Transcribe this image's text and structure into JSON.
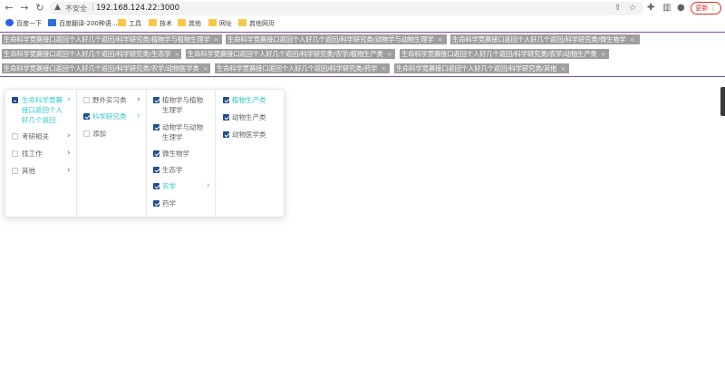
{
  "browser": {
    "insecure_label": "不安全",
    "url": "192.168.124.22:3000",
    "update_label": "更新"
  },
  "bookmarks": [
    {
      "label": "百度一下",
      "icon": "baidu-icon"
    },
    {
      "label": "百度翻译-200种语...",
      "icon": "translate-icon"
    },
    {
      "label": "工具",
      "icon": "folder-icon"
    },
    {
      "label": "技术",
      "icon": "folder-icon"
    },
    {
      "label": "其他",
      "icon": "folder-icon"
    },
    {
      "label": "网址",
      "icon": "folder-icon"
    },
    {
      "label": "其他网页",
      "icon": "folder-icon"
    }
  ],
  "tags": [
    "生命科学竞赛接口返回个人好几个返回/科学研究类/植物学与植物生理学",
    "生命科学竞赛接口返回个人好几个返回/科学研究类/动物学与动物生理学",
    "生命科学竞赛接口返回个人好几个返回/科学研究类/微生物学",
    "生命科学竞赛接口返回个人好几个返回/科学研究类/生态学",
    "生命科学竞赛接口返回个人好几个返回/科学研究类/农学/植物生产类",
    "生命科学竞赛接口返回个人好几个返回/科学研究类/农学/动物生产类",
    "生命科学竞赛接口返回个人好几个返回/科学研究类/农学/动物医学类",
    "生命科学竞赛接口返回个人好几个返回/科学研究类/药学",
    "生命科学竞赛接口返回个人好几个返回/科学研究类/其他"
  ],
  "cascader": {
    "col1": [
      "生命科学竞赛接口返回个人好几个返回",
      "考研相关",
      "找工作",
      "其他"
    ],
    "col2": [
      "野外实习类",
      "科学研究类",
      "添加"
    ],
    "col3": [
      "植物学与植物生理学",
      "动物学与动物生理学",
      "微生物学",
      "生态学",
      "农学",
      "药学"
    ],
    "col4": [
      "植物生产类",
      "动物生产类",
      "动物医学类"
    ]
  },
  "colors": {
    "accent": "#2ec7c9",
    "tag_bg": "#9e9e9e",
    "checkbox": "#1f4e8c",
    "divider": "#7a4fb0"
  }
}
